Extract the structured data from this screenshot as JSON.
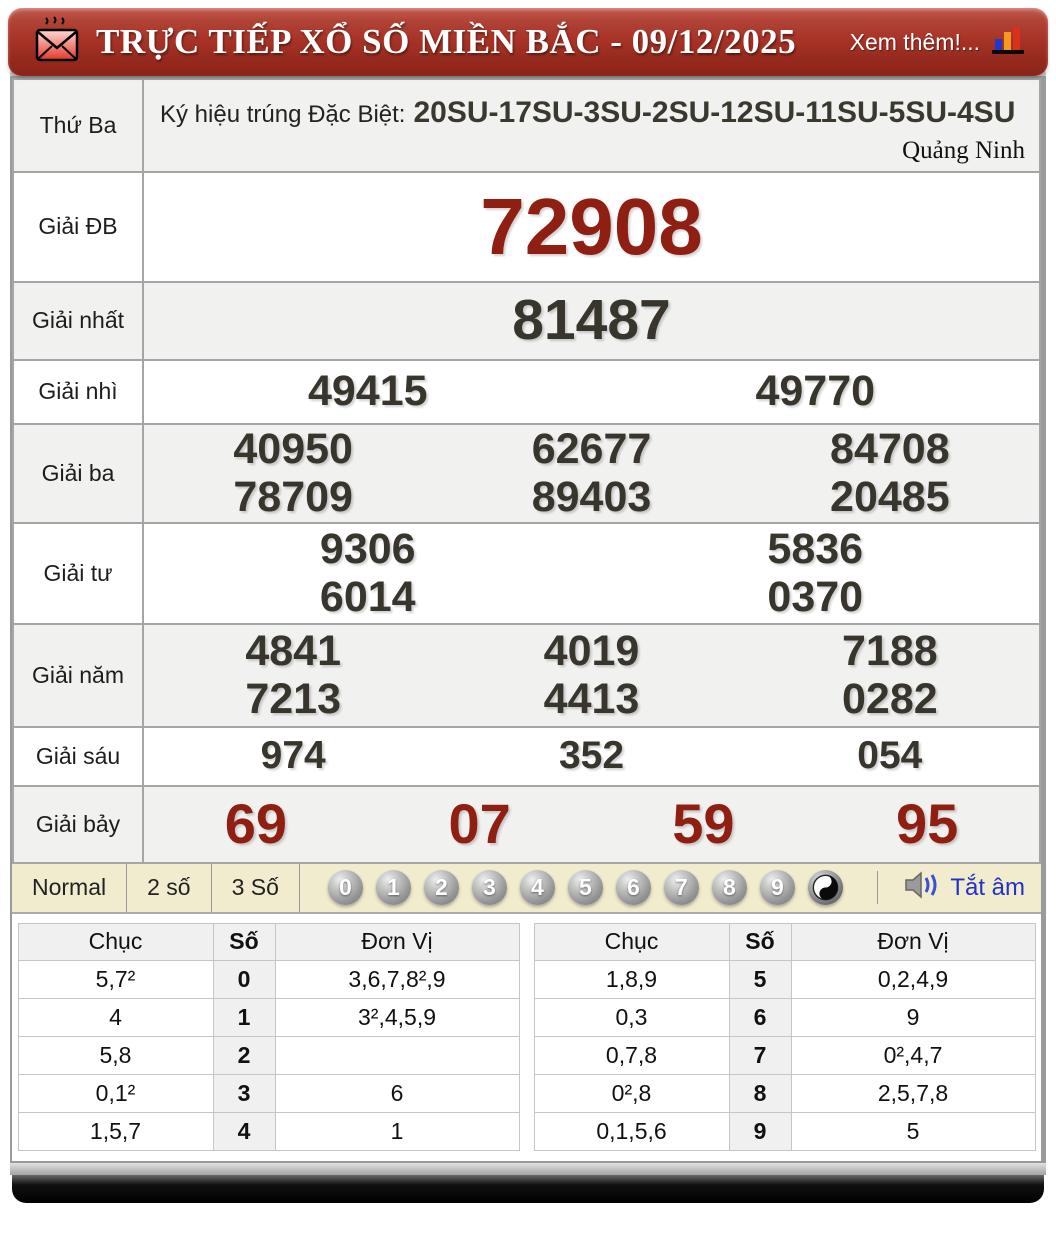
{
  "header": {
    "title": "TRỰC TIẾP XỔ SỐ MIỀN BẮC - 09/12/2025",
    "more_link": "Xem thêm!...",
    "accent_red": "#a93327"
  },
  "results": {
    "day_label": "Thứ Ba",
    "symbol_prefix": "Ký hiệu trúng Đặc Biệt:",
    "symbol_value": "20SU-17SU-3SU-2SU-12SU-11SU-5SU-4SU",
    "province": "Quảng Ninh",
    "special_color": "#8e1f12",
    "rows": [
      {
        "label": "Giải ĐB",
        "lines": [
          [
            "72908"
          ]
        ]
      },
      {
        "label": "Giải nhất",
        "lines": [
          [
            "81487"
          ]
        ]
      },
      {
        "label": "Giải nhì",
        "lines": [
          [
            "49415",
            "49770"
          ]
        ]
      },
      {
        "label": "Giải ba",
        "lines": [
          [
            "40950",
            "62677",
            "84708"
          ],
          [
            "78709",
            "89403",
            "20485"
          ]
        ]
      },
      {
        "label": "Giải tư",
        "lines": [
          [
            "9306",
            "5836"
          ],
          [
            "6014",
            "0370"
          ]
        ]
      },
      {
        "label": "Giải năm",
        "lines": [
          [
            "4841",
            "4019",
            "7188"
          ],
          [
            "7213",
            "4413",
            "0282"
          ]
        ]
      },
      {
        "label": "Giải sáu",
        "lines": [
          [
            "974",
            "352",
            "054"
          ]
        ]
      },
      {
        "label": "Giải bảy",
        "lines": [
          [
            "69",
            "07",
            "59",
            "95"
          ]
        ]
      }
    ]
  },
  "controls": {
    "modes": [
      "Normal",
      "2 số",
      "3 Số"
    ],
    "balls": [
      "0",
      "1",
      "2",
      "3",
      "4",
      "5",
      "6",
      "7",
      "8",
      "9"
    ],
    "mute_label": "Tắt âm"
  },
  "stats": {
    "headers": {
      "chuc": "Chục",
      "so": "Số",
      "donvi": "Đơn Vị"
    },
    "left_rows": [
      {
        "chuc": "5,7²",
        "so": "0",
        "donvi": "3,6,7,8²,9"
      },
      {
        "chuc": "4",
        "so": "1",
        "donvi": "3²,4,5,9"
      },
      {
        "chuc": "5,8",
        "so": "2",
        "donvi": ""
      },
      {
        "chuc": "0,1²",
        "so": "3",
        "donvi": "6"
      },
      {
        "chuc": "1,5,7",
        "so": "4",
        "donvi": "1"
      }
    ],
    "right_rows": [
      {
        "chuc": "1,8,9",
        "so": "5",
        "donvi": "0,2,4,9"
      },
      {
        "chuc": "0,3",
        "so": "6",
        "donvi": "9"
      },
      {
        "chuc": "0,7,8",
        "so": "7",
        "donvi": "0²,4,7"
      },
      {
        "chuc": "0²,8",
        "so": "8",
        "donvi": "2,5,7,8"
      },
      {
        "chuc": "0,1,5,6",
        "so": "9",
        "donvi": "5"
      }
    ]
  }
}
